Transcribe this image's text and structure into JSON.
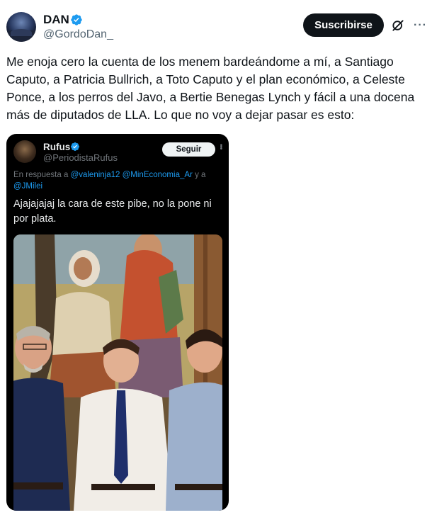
{
  "tweet": {
    "author_name": "DAN",
    "author_handle": "@GordoDan_",
    "subscribe_label": "Suscribirse",
    "text": "Me enoja cero la cuenta de los menem bardeándome a mí, a Santiago Caputo, a Patricia Bullrich, a Toto Caputo y el plan económico, a Celeste Ponce, a los perros del Javo, a Bertie Benegas Lynch y fácil a una docena más de diputados de LLA. Lo que no voy a dejar pasar es esto:"
  },
  "quoted": {
    "author_name": "Rufus",
    "author_handle": "@PeriodistaRufus",
    "follow_label": "Seguir",
    "reply_prefix": "En respuesta a",
    "reply_mentions": [
      "@valeninja12",
      "@MinEconomia_Ar"
    ],
    "reply_connector": "y a",
    "reply_last": "@JMilei",
    "text": "Ajajajajaj la cara de este pibe, no la pone ni por plata."
  },
  "colors": {
    "verified": "#1d9bf0",
    "text": "#0f1419",
    "secondary": "#536471",
    "dark_card": "#000000",
    "link": "#1d9bf0"
  },
  "icons": [
    "verified-badge-icon",
    "grok-icon",
    "more-icon"
  ]
}
